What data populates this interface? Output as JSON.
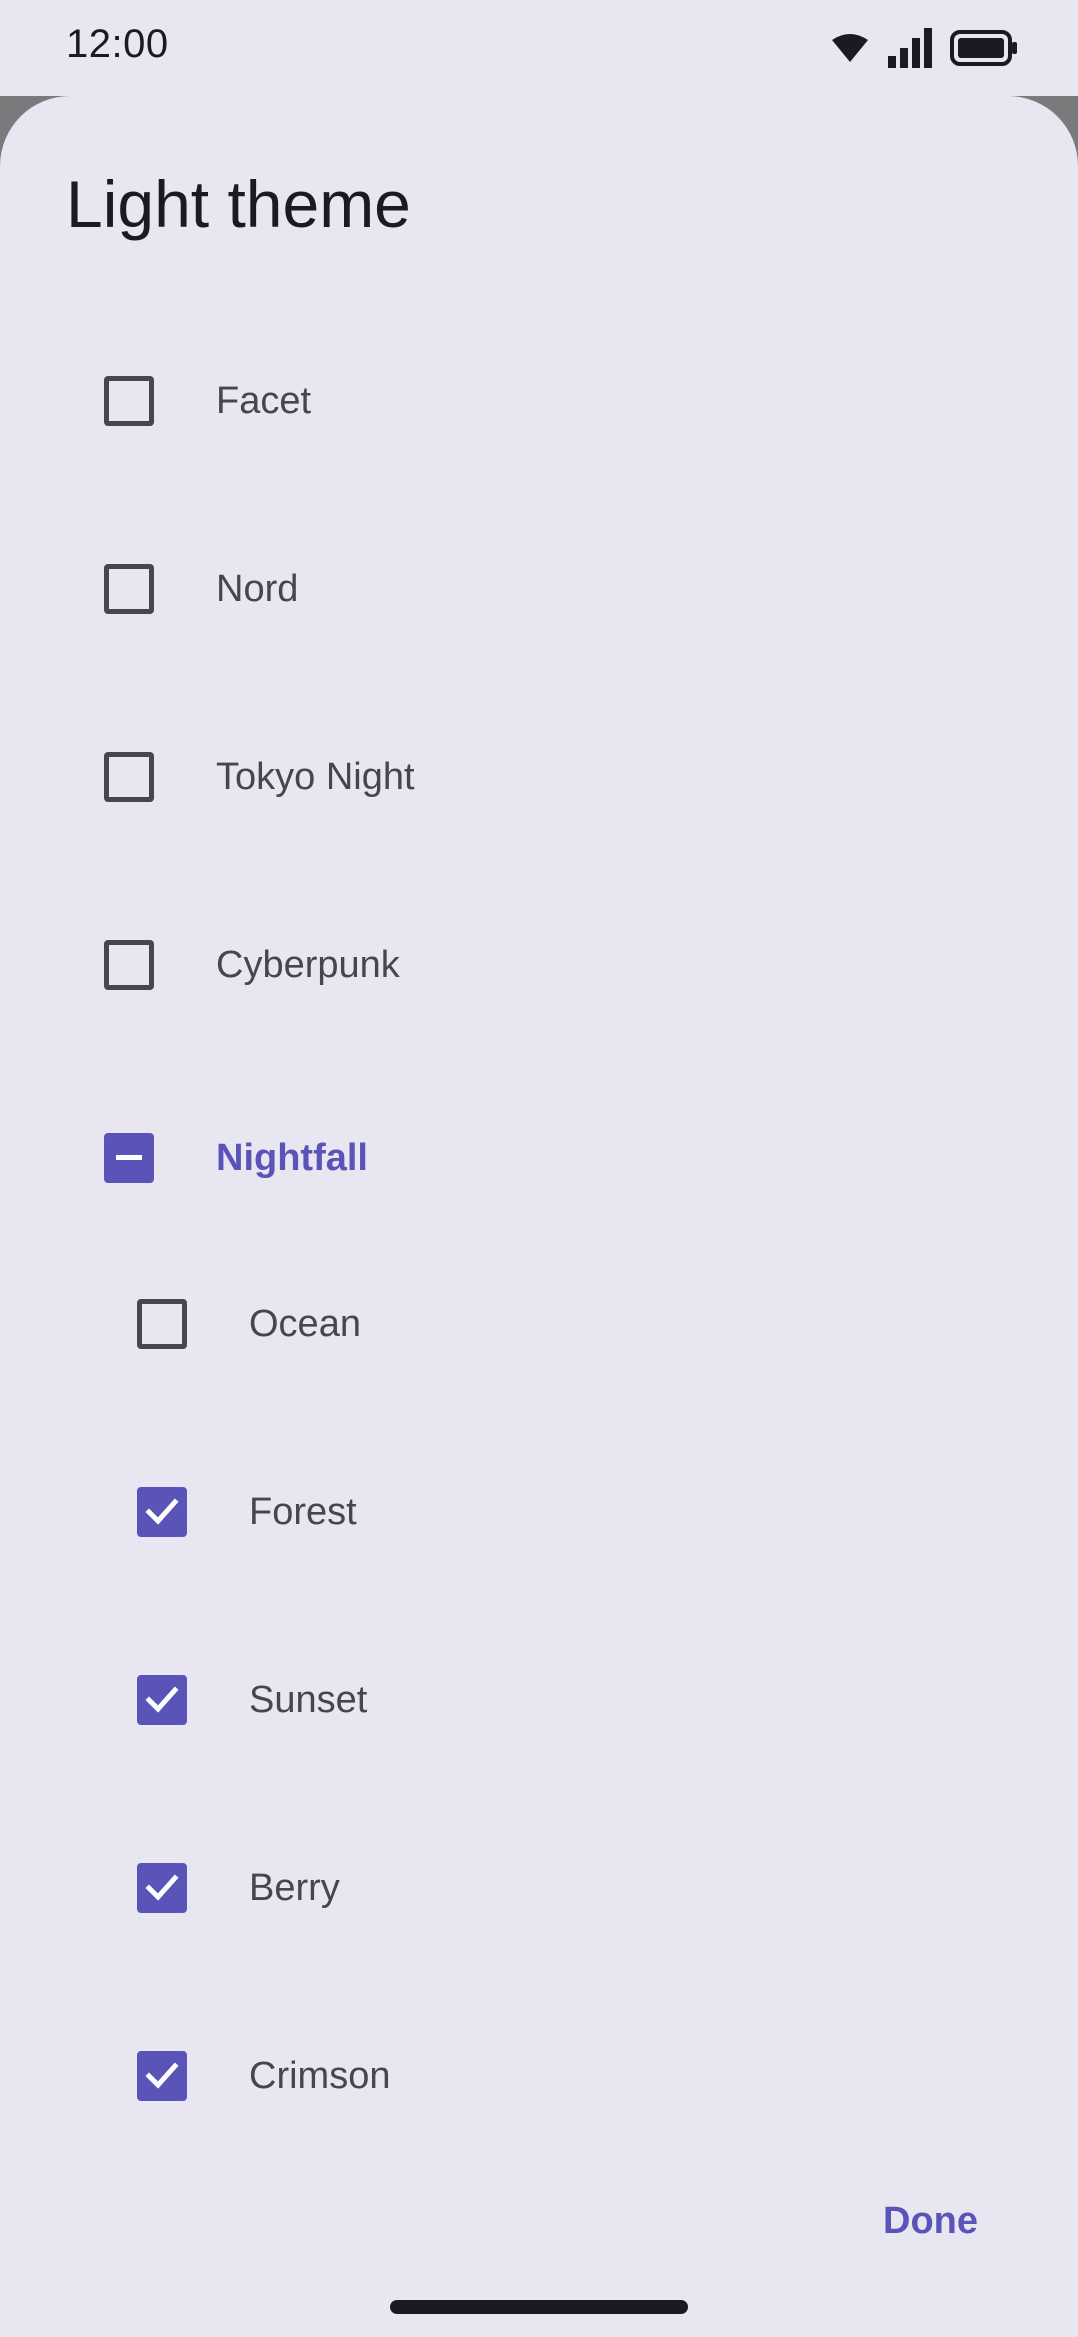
{
  "status_bar": {
    "time": "12:00",
    "icons": [
      "wifi-icon",
      "signal-icon",
      "battery-icon"
    ]
  },
  "dialog": {
    "title": "Light theme",
    "options": [
      {
        "label": "Facet",
        "state": "unchecked"
      },
      {
        "label": "Nord",
        "state": "unchecked"
      },
      {
        "label": "Tokyo Night",
        "state": "unchecked"
      },
      {
        "label": "Cyberpunk",
        "state": "unchecked"
      },
      {
        "label": "Nightfall",
        "state": "indeterminate"
      }
    ],
    "sub_options": [
      {
        "label": "Ocean",
        "state": "unchecked"
      },
      {
        "label": "Forest",
        "state": "checked"
      },
      {
        "label": "Sunset",
        "state": "checked"
      },
      {
        "label": "Berry",
        "state": "checked"
      },
      {
        "label": "Crimson",
        "state": "checked"
      }
    ],
    "done_label": "Done"
  },
  "colors": {
    "accent": "#5b54b8",
    "surface": "#e8e7f1",
    "on_surface": "#1b1a22",
    "on_surface_variant": "#47464f",
    "scrim": "#7a7a7c"
  }
}
